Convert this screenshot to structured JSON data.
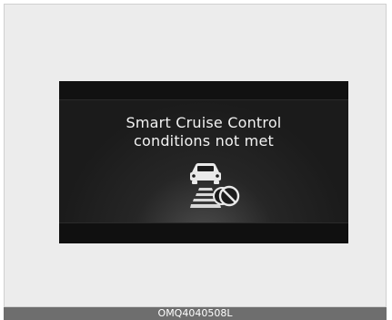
{
  "display": {
    "message_line1": "Smart Cruise Control",
    "message_line2": "conditions not met",
    "icon": "smart-cruise-control-unavailable-icon"
  },
  "caption": {
    "code": "OMQ4040508L"
  },
  "colors": {
    "display_background": "#1b1b1b",
    "text": "#f2f2f2",
    "caption_bar": "#6e6e6e"
  }
}
